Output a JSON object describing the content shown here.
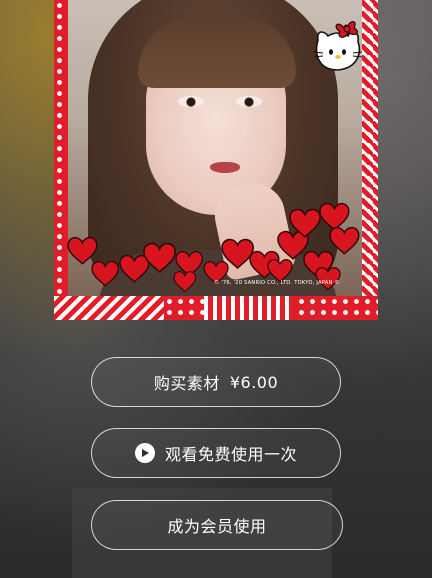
{
  "frame": {
    "theme_colors": {
      "red": "#e11d2a",
      "white": "#ffffff"
    },
    "copyright_text": "© '76, '20 SANRIO CO., LTD. TOKYO, JAPAN ©"
  },
  "actions": {
    "buy_label": "购买素材",
    "buy_price": "¥6.00",
    "watch_free_label": "观看免费使用一次",
    "member_label": "成为会员使用"
  },
  "icons": {
    "play": "play-icon"
  }
}
